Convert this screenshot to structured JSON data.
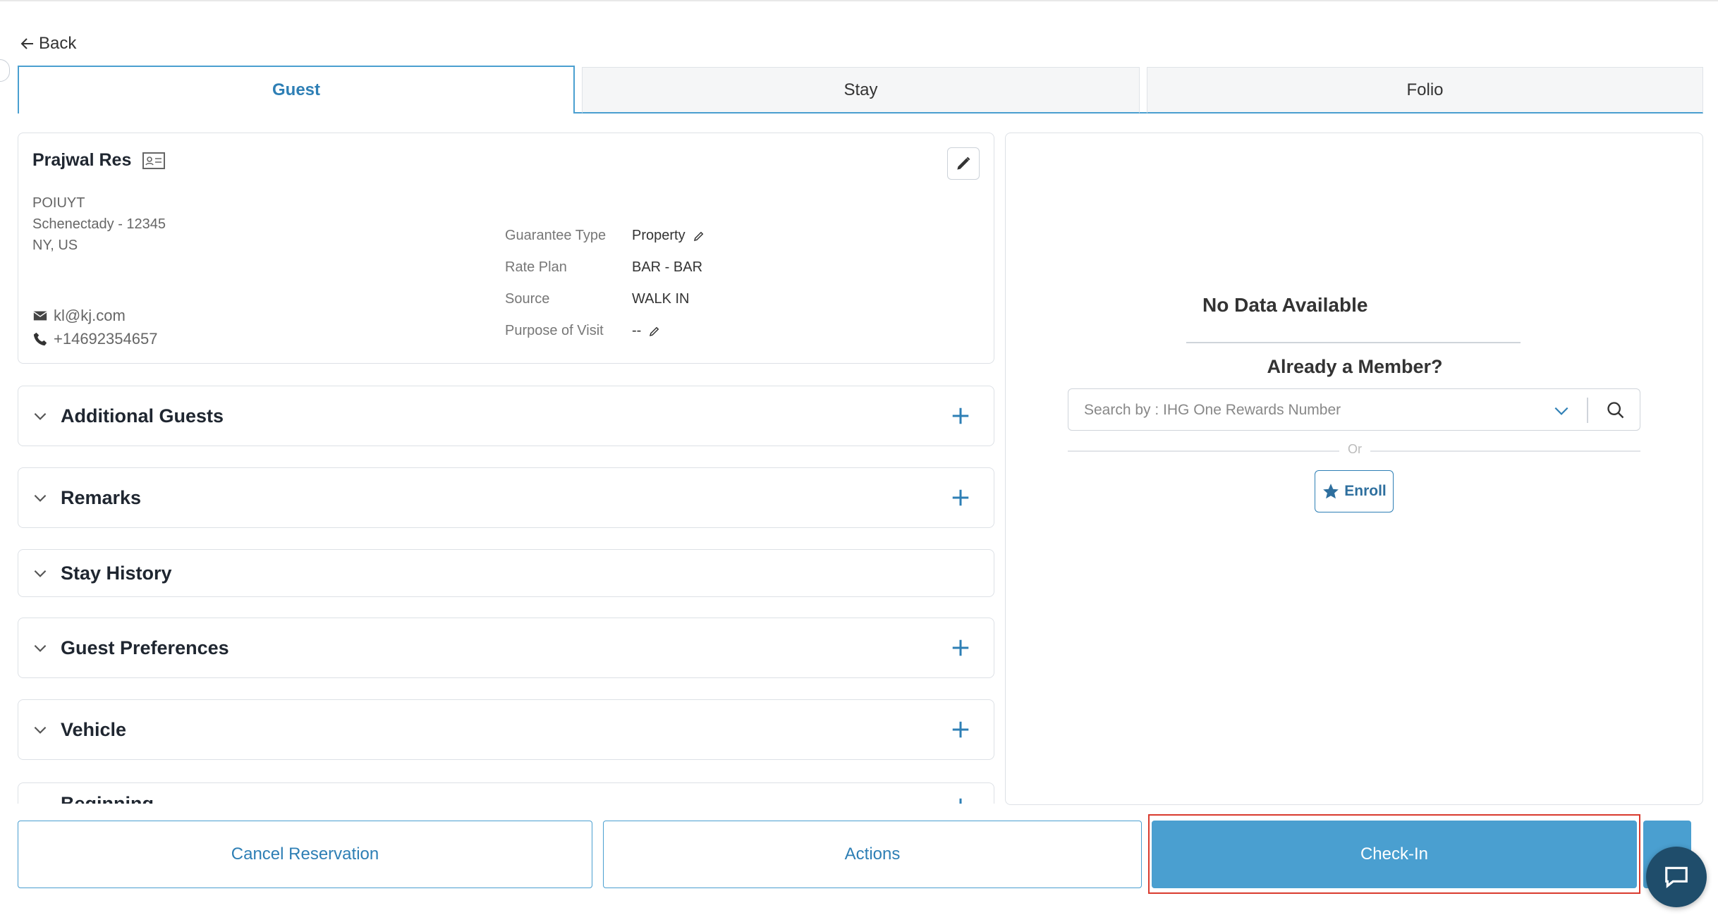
{
  "back": {
    "label": "Back"
  },
  "tabs": [
    {
      "label": "Guest"
    },
    {
      "label": "Stay"
    },
    {
      "label": "Folio"
    }
  ],
  "guest": {
    "name": "Prajwal Res",
    "address_line1": "POIUYT",
    "address_line2": "Schenectady  - 12345",
    "address_line3": "NY, US",
    "email": "kl@kj.com",
    "phone": "+14692354657",
    "details": {
      "guarantee_type_label": "Guarantee Type",
      "guarantee_type_value": "Property",
      "rate_plan_label": "Rate Plan",
      "rate_plan_value": "BAR - BAR",
      "source_label": "Source",
      "source_value": "WALK IN",
      "purpose_label": "Purpose of Visit",
      "purpose_value": "--"
    }
  },
  "sections": [
    {
      "title": "Additional Guests"
    },
    {
      "title": "Remarks"
    },
    {
      "title": "Stay History"
    },
    {
      "title": "Guest Preferences"
    },
    {
      "title": "Vehicle"
    },
    {
      "title": "Beginning"
    }
  ],
  "loyalty": {
    "no_data": "No Data Available",
    "member_heading": "Already a Member?",
    "search_placeholder": "Search by : IHG One Rewards Number",
    "or_text": "Or",
    "enroll_label": "Enroll"
  },
  "footer": {
    "cancel_label": "Cancel Reservation",
    "actions_label": "Actions",
    "checkin_label": "Check-In"
  },
  "colors": {
    "accent": "#4a9fd0",
    "highlight": "#d93a2e"
  }
}
